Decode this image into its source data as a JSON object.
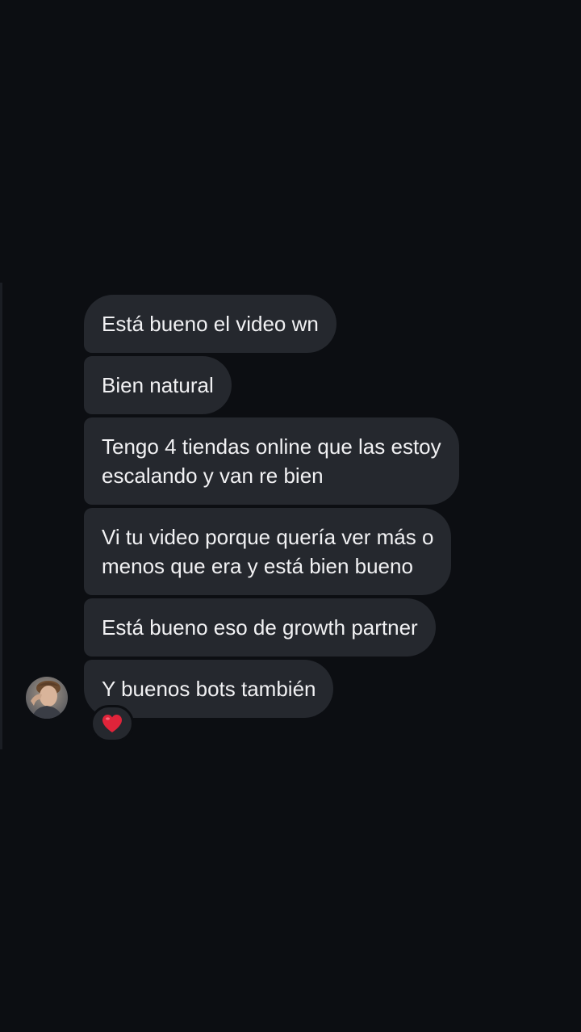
{
  "thread": {
    "messages": [
      {
        "text": "Está bueno el video wn"
      },
      {
        "text": "Bien natural"
      },
      {
        "text": "Tengo 4 tiendas online que las estoy\nescalando y van re bien"
      },
      {
        "text": "Vi tu video porque quería ver más o\nmenos que era y está bien bueno"
      },
      {
        "text": "Está bueno eso de growth partner"
      },
      {
        "text": "Y buenos bots también"
      }
    ],
    "reaction": {
      "icon": "heart-icon",
      "color": "#e0243a"
    },
    "avatar": {
      "icon": "user-avatar"
    }
  },
  "colors": {
    "background": "#0c0e12",
    "bubble": "#25282e",
    "text": "#f1f1f3"
  }
}
